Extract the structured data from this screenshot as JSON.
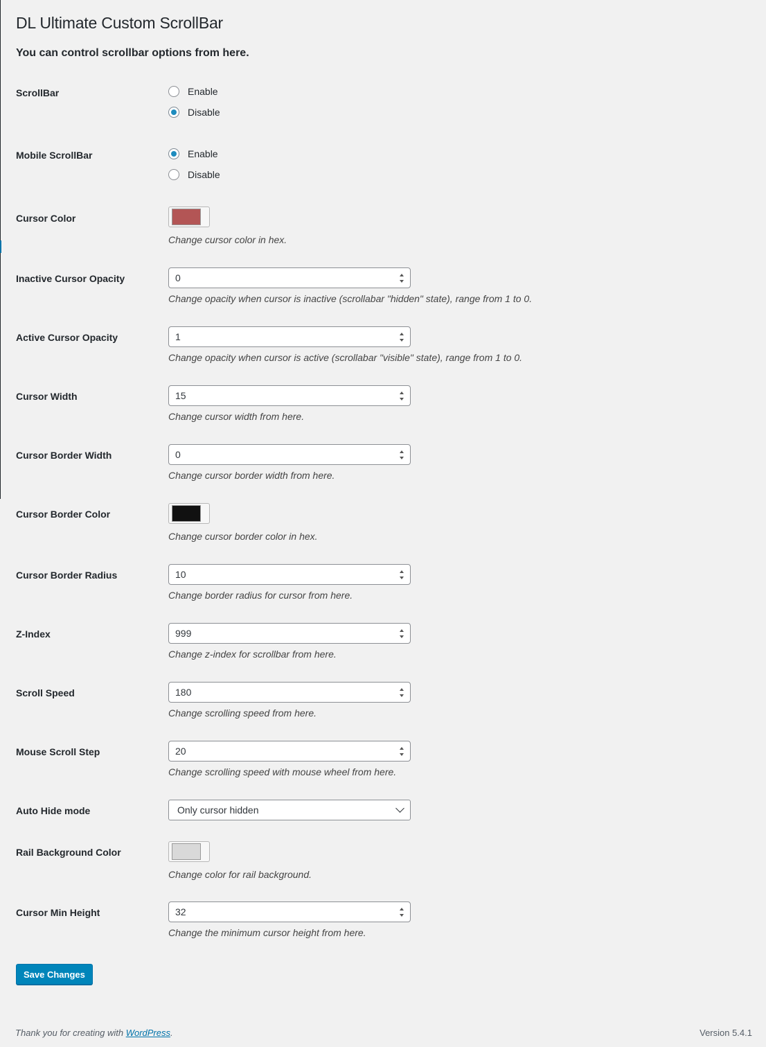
{
  "page": {
    "title": "DL Ultimate Custom ScrollBar",
    "subtitle": "You can control scrollbar options from here."
  },
  "fields": {
    "scrollbar": {
      "label": "ScrollBar",
      "options": [
        "Enable",
        "Disable"
      ],
      "selected": "Disable"
    },
    "mobile_scrollbar": {
      "label": "Mobile ScrollBar",
      "options": [
        "Enable",
        "Disable"
      ],
      "selected": "Enable"
    },
    "cursor_color": {
      "label": "Cursor Color",
      "color": "#b35555",
      "description": "Change cursor color in hex."
    },
    "inactive_cursor_opacity": {
      "label": "Inactive Cursor Opacity",
      "value": "0",
      "description": "Change opacity when cursor is inactive (scrollabar \"hidden\" state), range from 1 to 0."
    },
    "active_cursor_opacity": {
      "label": "Active Cursor Opacity",
      "value": "1",
      "description": "Change opacity when cursor is active (scrollabar \"visible\" state), range from 1 to 0."
    },
    "cursor_width": {
      "label": "Cursor Width",
      "value": "15",
      "description": "Change cursor width from here."
    },
    "cursor_border_width": {
      "label": "Cursor Border Width",
      "value": "0",
      "description": "Change cursor border width from here."
    },
    "cursor_border_color": {
      "label": "Cursor Border Color",
      "color": "#111111",
      "description": "Change cursor border color in hex."
    },
    "cursor_border_radius": {
      "label": "Cursor Border Radius",
      "value": "10",
      "description": "Change border radius for cursor from here."
    },
    "z_index": {
      "label": "Z-Index",
      "value": "999",
      "description": "Change z-index for scrollbar from here."
    },
    "scroll_speed": {
      "label": "Scroll Speed",
      "value": "180",
      "description": "Change scrolling speed from here."
    },
    "mouse_scroll_step": {
      "label": "Mouse Scroll Step",
      "value": "20",
      "description": "Change scrolling speed with mouse wheel from here."
    },
    "auto_hide_mode": {
      "label": "Auto Hide mode",
      "value": "Only cursor hidden"
    },
    "rail_background_color": {
      "label": "Rail Background Color",
      "color": "#d9d9d9",
      "description": "Change color for rail background."
    },
    "cursor_min_height": {
      "label": "Cursor Min Height",
      "value": "32",
      "description": "Change the minimum cursor height from here."
    }
  },
  "actions": {
    "save_label": "Save Changes"
  },
  "footer": {
    "thanks_prefix": "Thank you for creating with ",
    "thanks_link": "WordPress",
    "thanks_suffix": ".",
    "version": "Version 5.4.1"
  },
  "icons": {
    "spinner": "number-spinner-icon",
    "dropdown": "chevron-down-icon"
  }
}
